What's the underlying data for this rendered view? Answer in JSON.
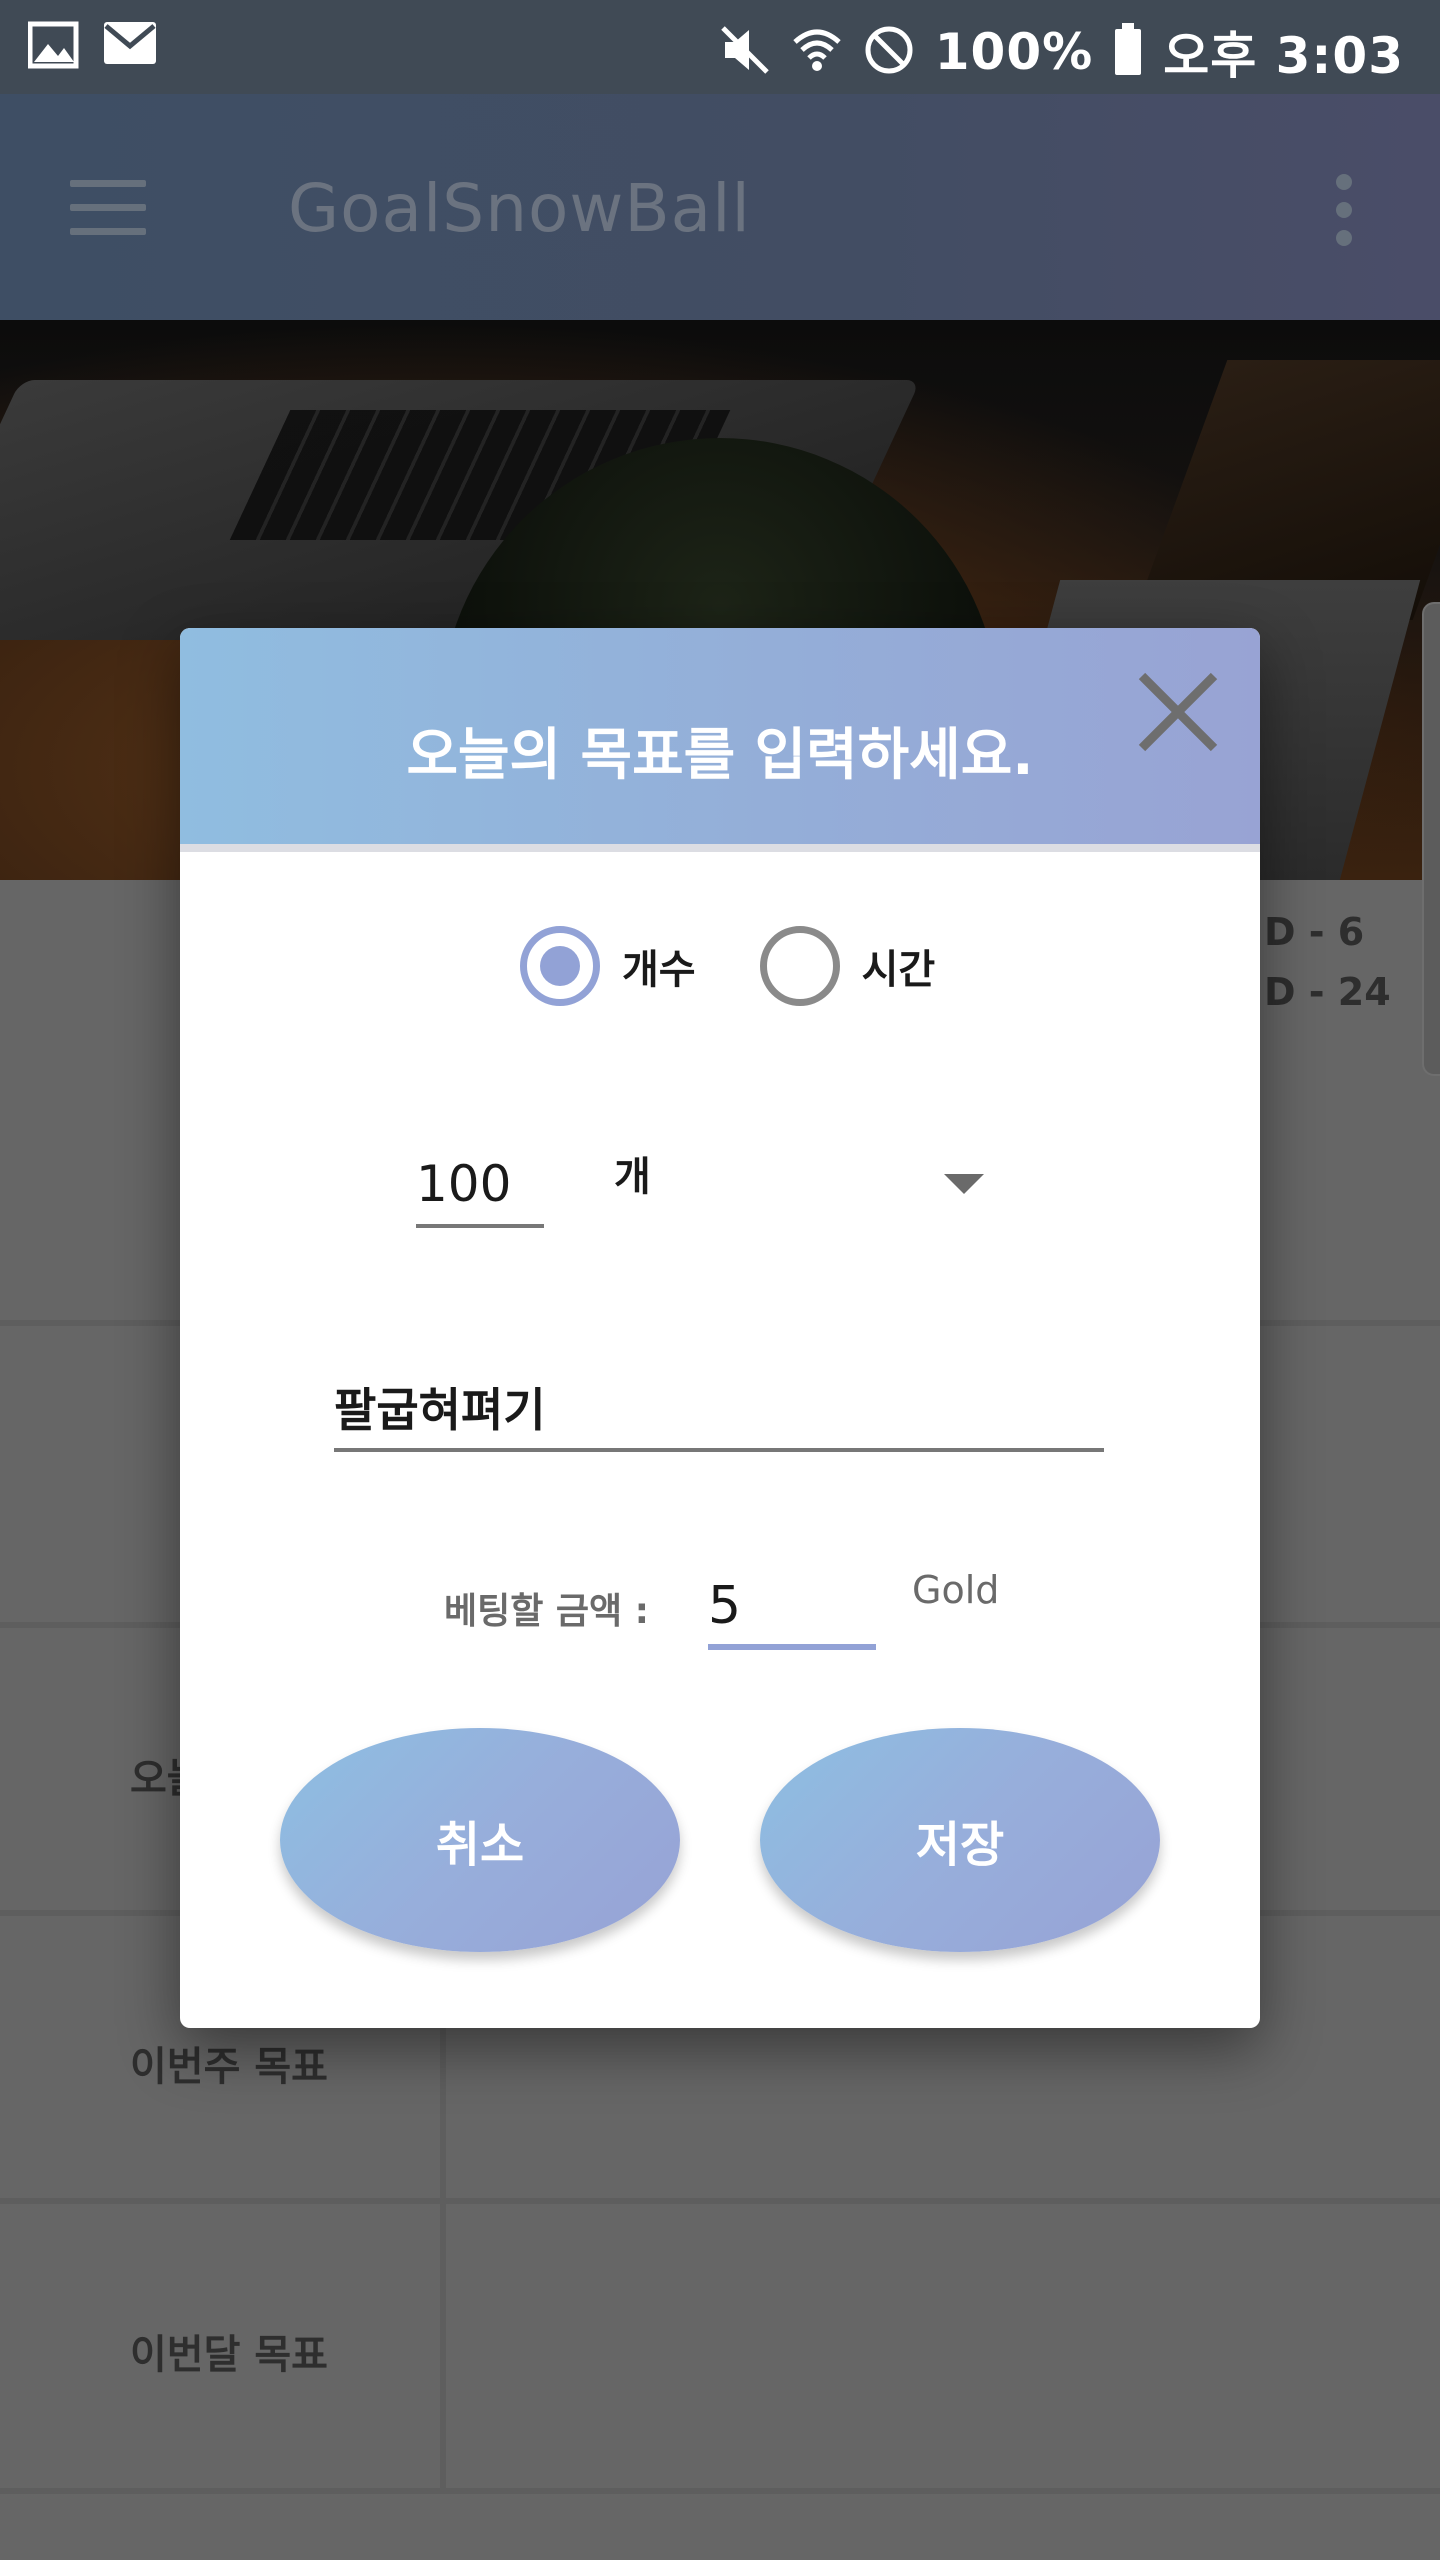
{
  "status_bar": {
    "battery": "100%",
    "time": "오후 3:03"
  },
  "app_bar": {
    "title": "GoalSnowBall"
  },
  "background": {
    "ddays": [
      "D - 6",
      "D - 24"
    ],
    "rows": [
      {
        "label": ""
      },
      {
        "label": ""
      },
      {
        "label": "오늘의 목표"
      },
      {
        "label": "이번주 목표"
      },
      {
        "label": "이번달 목표"
      }
    ]
  },
  "dialog": {
    "title": "오늘의 목표를 입력하세요.",
    "radio_options": [
      {
        "label": "개수",
        "selected": true
      },
      {
        "label": "시간",
        "selected": false
      }
    ],
    "count_value": "100",
    "unit_selected": "개",
    "goal_value": "팔굽혀펴기",
    "bet_label": "베팅할 금액 :",
    "bet_value": "5",
    "bet_unit": "Gold",
    "cancel_label": "취소",
    "save_label": "저장"
  },
  "colors": {
    "accent": "#92a2d6",
    "header_gradient_start": "#90bde0",
    "header_gradient_end": "#98a3d4"
  }
}
